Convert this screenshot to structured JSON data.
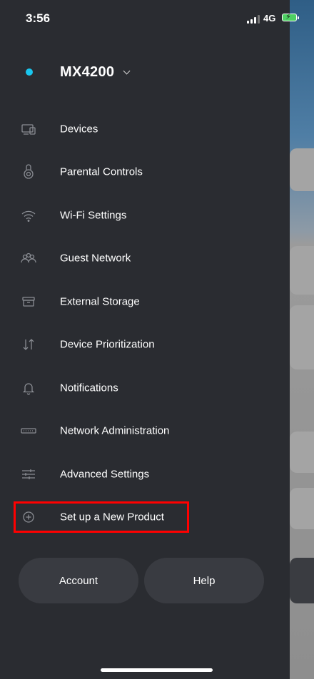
{
  "status_bar": {
    "time": "3:56",
    "network": "4G"
  },
  "header": {
    "router_name": "MX4200"
  },
  "menu": {
    "items": [
      {
        "label": "Devices",
        "icon": "devices-icon"
      },
      {
        "label": "Parental Controls",
        "icon": "parental-controls-icon"
      },
      {
        "label": "Wi-Fi Settings",
        "icon": "wifi-icon"
      },
      {
        "label": "Guest Network",
        "icon": "guest-network-icon"
      },
      {
        "label": "External Storage",
        "icon": "external-storage-icon"
      },
      {
        "label": "Device Prioritization",
        "icon": "prioritization-icon"
      },
      {
        "label": "Notifications",
        "icon": "bell-icon"
      },
      {
        "label": "Network Administration",
        "icon": "router-icon"
      },
      {
        "label": "Advanced Settings",
        "icon": "sliders-icon"
      },
      {
        "label": "Set up a New Product",
        "icon": "plus-circle-icon"
      }
    ]
  },
  "buttons": {
    "account": "Account",
    "help": "Help"
  },
  "colors": {
    "drawer_bg": "#2a2c31",
    "status_dot": "#19c6ee",
    "highlight": "#ff0000",
    "pill_bg": "#393b41"
  }
}
